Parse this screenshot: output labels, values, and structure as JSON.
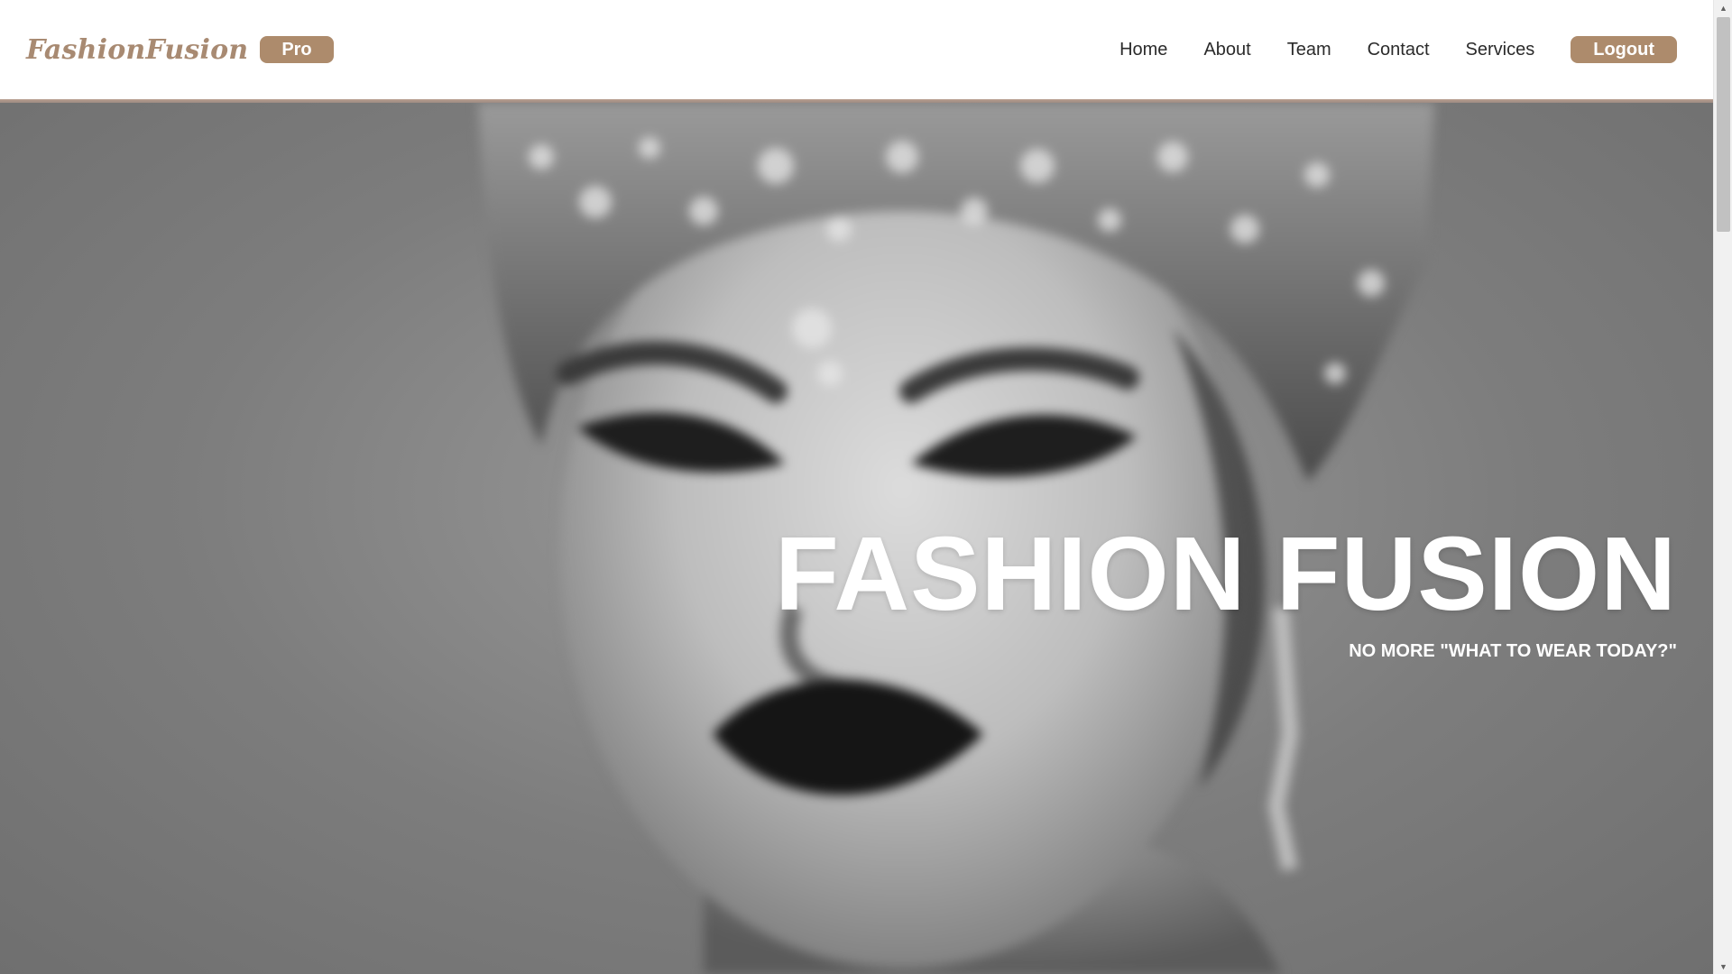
{
  "navbar": {
    "logo": "FashionFusion",
    "badge": "Pro",
    "links": [
      {
        "label": "Home"
      },
      {
        "label": "About"
      },
      {
        "label": "Team"
      },
      {
        "label": "Contact"
      },
      {
        "label": "Services"
      }
    ],
    "logout_label": "Logout"
  },
  "hero": {
    "title": "FASHION FUSION",
    "subtitle": "NO MORE \"WHAT TO WEAR TODAY?\"",
    "image_icon": "fashion-portrait-image"
  },
  "scrollbar": {
    "up_icon": "scroll-up-arrow-icon",
    "down_icon": "scroll-down-arrow-icon"
  },
  "colors": {
    "accent": "#ad8b6c",
    "logo": "#a88a72",
    "nav_text": "#2b2b2b",
    "hero_text": "#ffffff"
  }
}
